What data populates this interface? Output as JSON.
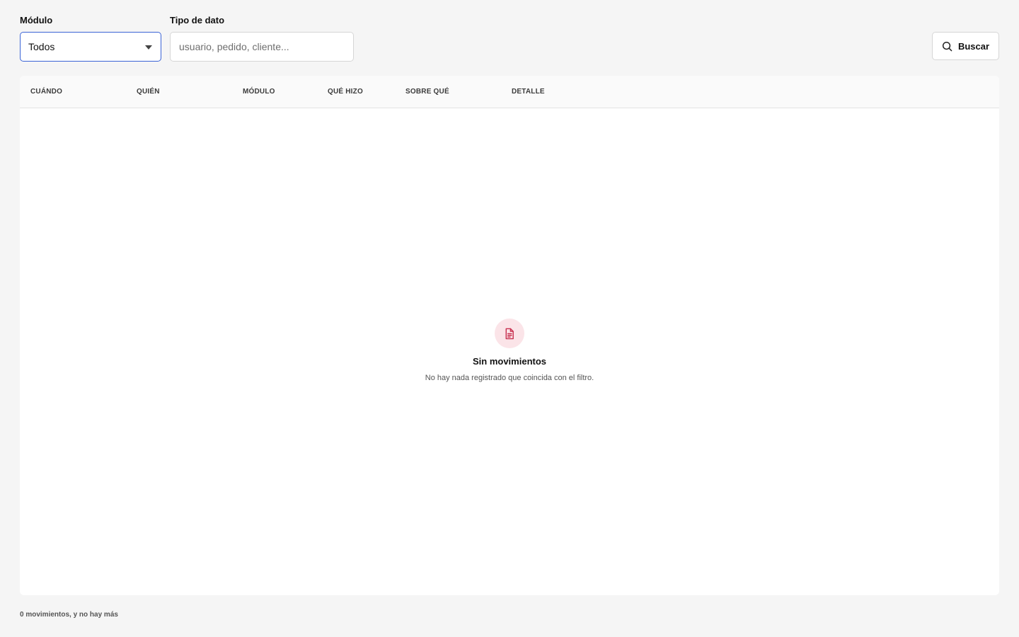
{
  "filters": {
    "modulo": {
      "label": "Módulo",
      "selected": "Todos"
    },
    "tipo_dato": {
      "label": "Tipo de dato",
      "placeholder": "usuario, pedido, cliente...",
      "value": ""
    },
    "search_button": {
      "label": "Buscar",
      "icon": "search-icon"
    }
  },
  "table": {
    "columns": [
      "CUÁNDO",
      "QUIÉN",
      "MÓDULO",
      "QUÉ HIZO",
      "SOBRE QUÉ",
      "DETALLE"
    ],
    "rows": []
  },
  "empty_state": {
    "icon": "document-icon",
    "title": "Sin movimientos",
    "subtitle": "No hay nada registrado que coincida con el filtro."
  },
  "footer": {
    "status": "0 movimientos, y no hay más"
  },
  "colors": {
    "accent_border": "#3b64d6",
    "empty_icon_bg": "#fbe4e8",
    "empty_icon_fg": "#c8304f"
  }
}
